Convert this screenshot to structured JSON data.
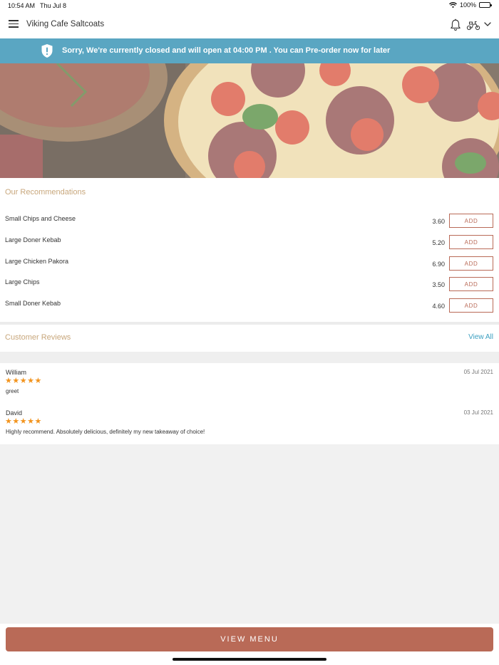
{
  "status_bar": {
    "time": "10:54 AM",
    "date": "Thu Jul 8",
    "battery_percent": "100%"
  },
  "header": {
    "title": "Viking Cafe Saltcoats"
  },
  "banner": {
    "message": "Sorry, We're currently closed and will open at 04:00 PM . You can Pre-order now for later",
    "color": "#5aa6c2"
  },
  "recommendations": {
    "title": "Our Recommendations",
    "add_label": "ADD",
    "items": [
      {
        "name": "Small Chips and Cheese",
        "price": "3.60"
      },
      {
        "name": "Large Doner Kebab",
        "price": "5.20"
      },
      {
        "name": "Large Chicken Pakora",
        "price": "6.90"
      },
      {
        "name": "Large Chips",
        "price": "3.50"
      },
      {
        "name": "Small Doner Kebab",
        "price": "4.60"
      }
    ]
  },
  "reviews": {
    "title": "Customer Reviews",
    "view_all_label": "View All",
    "items": [
      {
        "author": "William",
        "date": "05 Jul 2021",
        "rating": 5,
        "stars": "★★★★★",
        "text": "greet"
      },
      {
        "author": "David",
        "date": "03 Jul 2021",
        "rating": 5,
        "stars": "★★★★★",
        "text": "Highly recommend. Absolutely delicious, definitely my new takeaway of choice!"
      }
    ]
  },
  "footer": {
    "view_menu_label": "VIEW MENU",
    "accent_color": "#b96a57"
  }
}
